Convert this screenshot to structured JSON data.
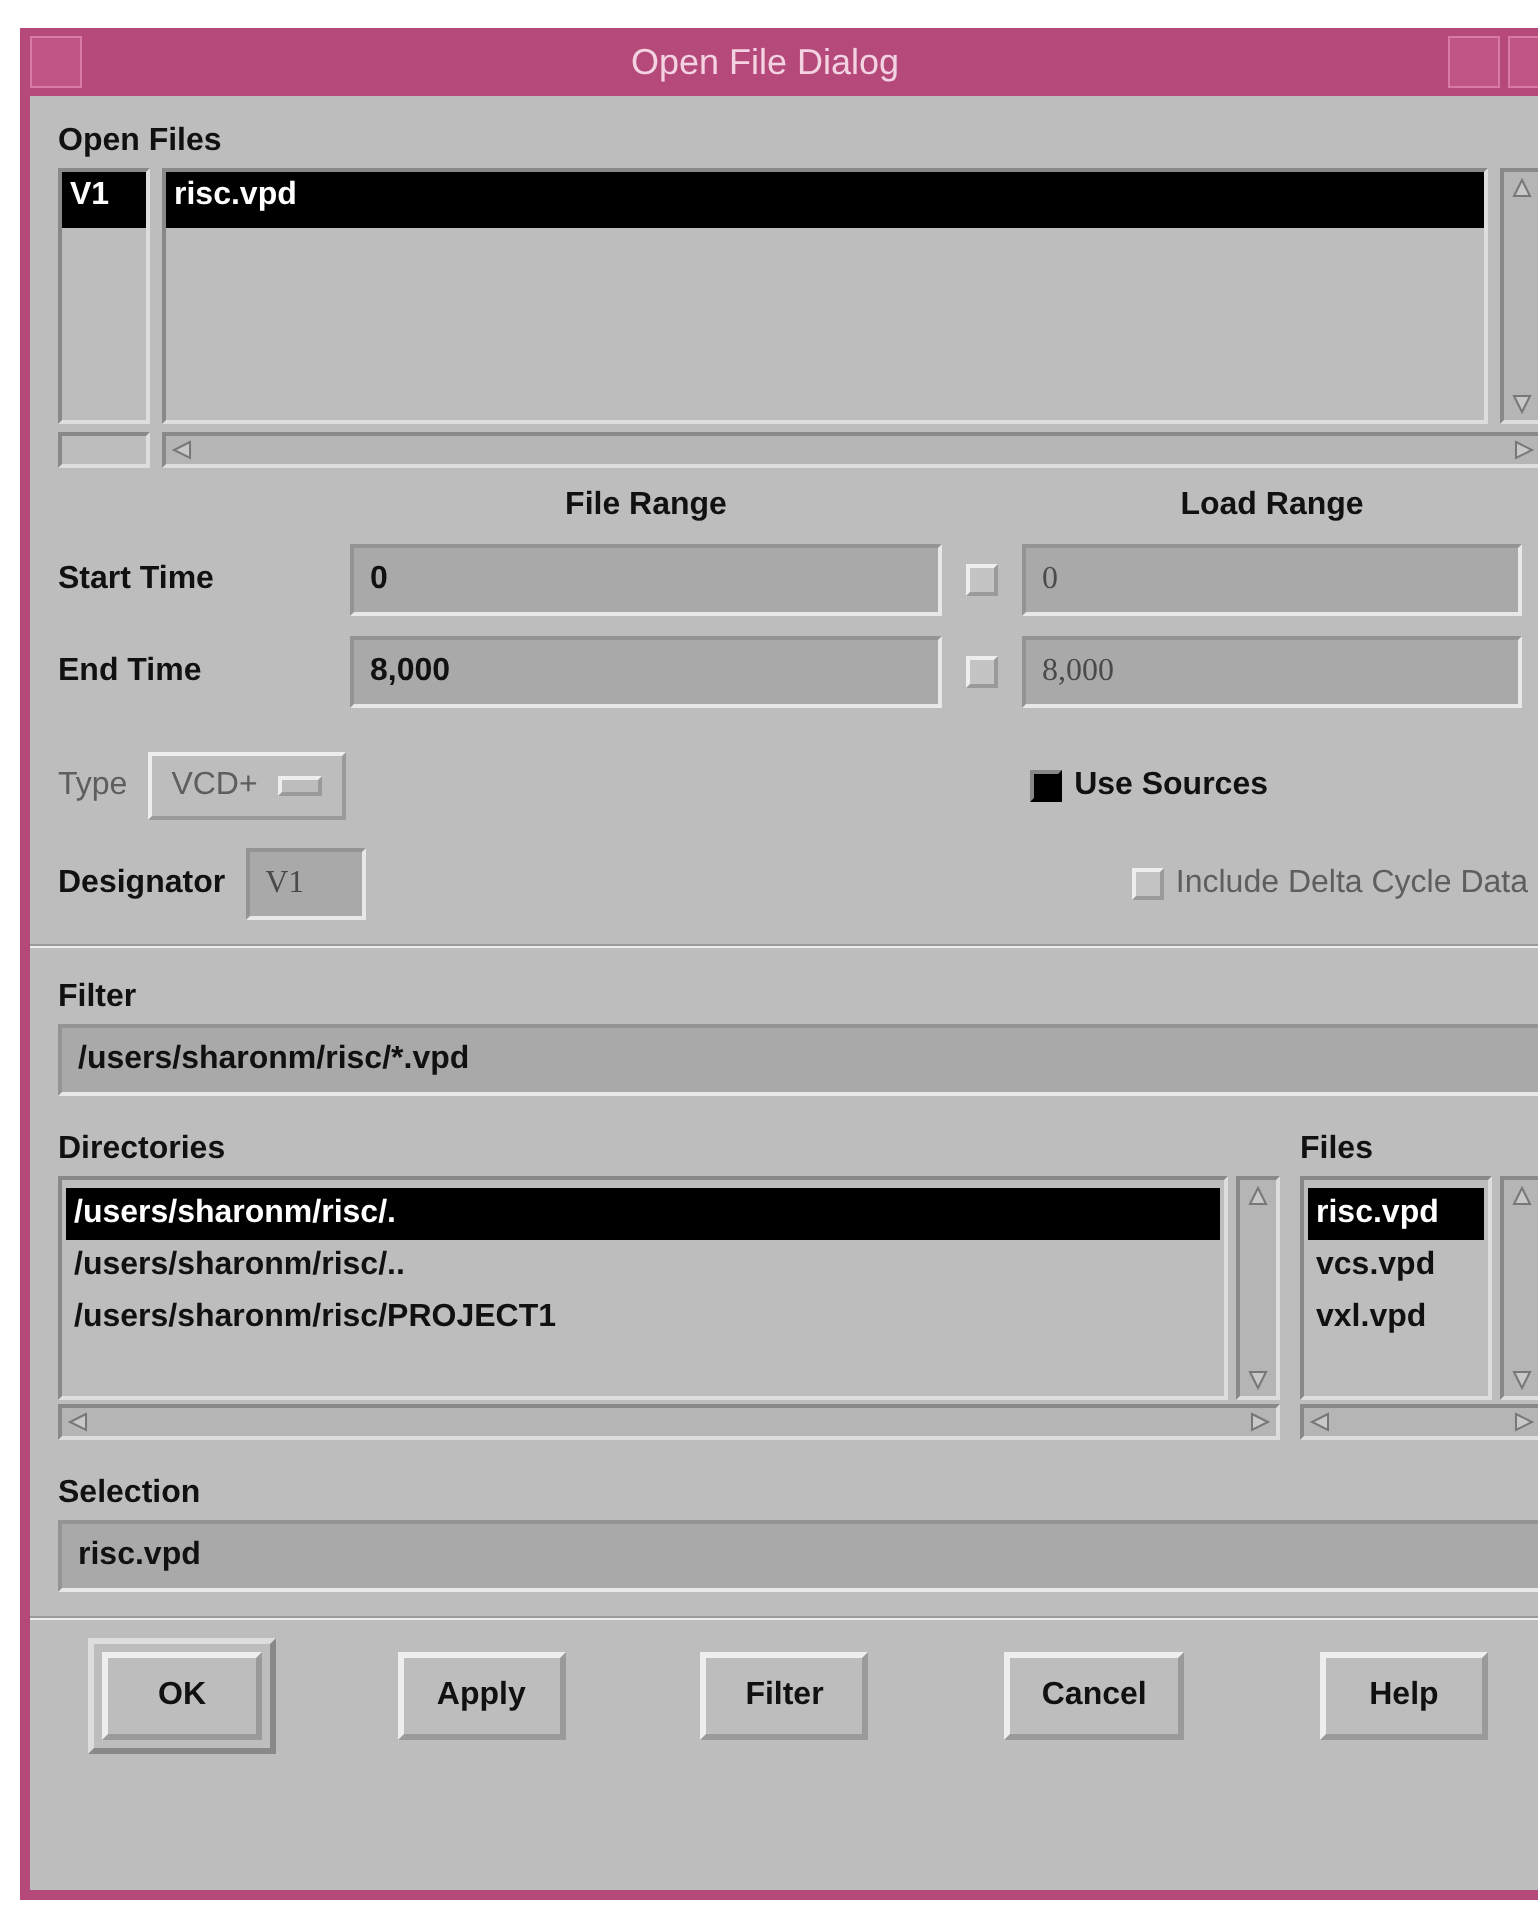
{
  "window": {
    "title": "Open File Dialog"
  },
  "open_files": {
    "label": "Open Files",
    "rows": [
      {
        "designator": "V1",
        "file": "risc.vpd",
        "selected": true
      }
    ]
  },
  "range": {
    "file_range_label": "File Range",
    "load_range_label": "Load Range",
    "rows": [
      {
        "label": "Start Time",
        "file_value": "0",
        "load_checked": false,
        "load_value": "0",
        "load_disabled": true
      },
      {
        "label": "End Time",
        "file_value": "8,000",
        "load_checked": false,
        "load_value": "8,000",
        "load_disabled": true
      }
    ]
  },
  "type": {
    "label": "Type",
    "value": "VCD+",
    "disabled": true
  },
  "designator": {
    "label": "Designator",
    "value": "V1"
  },
  "use_sources": {
    "label": "Use Sources",
    "checked": true,
    "disabled": false
  },
  "include_delta": {
    "label": "Include Delta Cycle Data",
    "checked": false,
    "disabled": true
  },
  "filter": {
    "label": "Filter",
    "value": "/users/sharonm/risc/*.vpd"
  },
  "directories": {
    "label": "Directories",
    "items": [
      {
        "text": "/users/sharonm/risc/.",
        "selected": true
      },
      {
        "text": "/users/sharonm/risc/..",
        "selected": false
      },
      {
        "text": "/users/sharonm/risc/PROJECT1",
        "selected": false
      }
    ]
  },
  "files": {
    "label": "Files",
    "items": [
      {
        "text": "risc.vpd",
        "selected": true
      },
      {
        "text": "vcs.vpd",
        "selected": false
      },
      {
        "text": "vxl.vpd",
        "selected": false
      }
    ]
  },
  "selection": {
    "label": "Selection",
    "value": "risc.vpd"
  },
  "buttons": [
    {
      "label": "OK",
      "default": true
    },
    {
      "label": "Apply",
      "default": false
    },
    {
      "label": "Filter",
      "default": false
    },
    {
      "label": "Cancel",
      "default": false
    },
    {
      "label": "Help",
      "default": false
    }
  ]
}
